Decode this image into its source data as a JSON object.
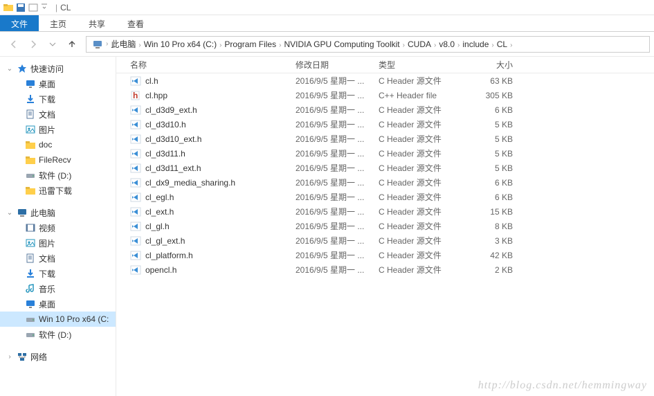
{
  "title_bar": {
    "text": "CL",
    "sep": "|"
  },
  "ribbon": {
    "file": "文件",
    "home": "主页",
    "share": "共享",
    "view": "查看"
  },
  "breadcrumbs": [
    "此电脑",
    "Win 10 Pro x64 (C:)",
    "Program Files",
    "NVIDIA GPU Computing Toolkit",
    "CUDA",
    "v8.0",
    "include",
    "CL"
  ],
  "columns": {
    "name": "名称",
    "date": "修改日期",
    "type": "类型",
    "size": "大小"
  },
  "sidebar": {
    "quick": {
      "label": "快速访问",
      "items": [
        {
          "label": "桌面",
          "icon": "desktop"
        },
        {
          "label": "下载",
          "icon": "download"
        },
        {
          "label": "文档",
          "icon": "document"
        },
        {
          "label": "图片",
          "icon": "picture"
        },
        {
          "label": "doc",
          "icon": "folder"
        },
        {
          "label": "FileRecv",
          "icon": "folder"
        },
        {
          "label": "软件 (D:)",
          "icon": "drive"
        },
        {
          "label": "迅雷下载",
          "icon": "folder"
        }
      ]
    },
    "pc": {
      "label": "此电脑",
      "items": [
        {
          "label": "视频",
          "icon": "video"
        },
        {
          "label": "图片",
          "icon": "picture"
        },
        {
          "label": "文档",
          "icon": "document"
        },
        {
          "label": "下载",
          "icon": "download"
        },
        {
          "label": "音乐",
          "icon": "music"
        },
        {
          "label": "桌面",
          "icon": "desktop"
        },
        {
          "label": "Win 10 Pro x64 (C:",
          "icon": "drive",
          "selected": true
        },
        {
          "label": "软件 (D:)",
          "icon": "drive"
        }
      ]
    },
    "network": {
      "label": "网络"
    }
  },
  "files": [
    {
      "name": "cl.h",
      "icon": "vs",
      "date": "2016/9/5 星期一 ...",
      "type": "C Header 源文件",
      "size": "63 KB"
    },
    {
      "name": "cl.hpp",
      "icon": "hpp",
      "date": "2016/9/5 星期一 ...",
      "type": "C++ Header file",
      "size": "305 KB"
    },
    {
      "name": "cl_d3d9_ext.h",
      "icon": "vs",
      "date": "2016/9/5 星期一 ...",
      "type": "C Header 源文件",
      "size": "6 KB"
    },
    {
      "name": "cl_d3d10.h",
      "icon": "vs",
      "date": "2016/9/5 星期一 ...",
      "type": "C Header 源文件",
      "size": "5 KB"
    },
    {
      "name": "cl_d3d10_ext.h",
      "icon": "vs",
      "date": "2016/9/5 星期一 ...",
      "type": "C Header 源文件",
      "size": "5 KB"
    },
    {
      "name": "cl_d3d11.h",
      "icon": "vs",
      "date": "2016/9/5 星期一 ...",
      "type": "C Header 源文件",
      "size": "5 KB"
    },
    {
      "name": "cl_d3d11_ext.h",
      "icon": "vs",
      "date": "2016/9/5 星期一 ...",
      "type": "C Header 源文件",
      "size": "5 KB"
    },
    {
      "name": "cl_dx9_media_sharing.h",
      "icon": "vs",
      "date": "2016/9/5 星期一 ...",
      "type": "C Header 源文件",
      "size": "6 KB"
    },
    {
      "name": "cl_egl.h",
      "icon": "vs",
      "date": "2016/9/5 星期一 ...",
      "type": "C Header 源文件",
      "size": "6 KB"
    },
    {
      "name": "cl_ext.h",
      "icon": "vs",
      "date": "2016/9/5 星期一 ...",
      "type": "C Header 源文件",
      "size": "15 KB"
    },
    {
      "name": "cl_gl.h",
      "icon": "vs",
      "date": "2016/9/5 星期一 ...",
      "type": "C Header 源文件",
      "size": "8 KB"
    },
    {
      "name": "cl_gl_ext.h",
      "icon": "vs",
      "date": "2016/9/5 星期一 ...",
      "type": "C Header 源文件",
      "size": "3 KB"
    },
    {
      "name": "cl_platform.h",
      "icon": "vs",
      "date": "2016/9/5 星期一 ...",
      "type": "C Header 源文件",
      "size": "42 KB"
    },
    {
      "name": "opencl.h",
      "icon": "vs",
      "date": "2016/9/5 星期一 ...",
      "type": "C Header 源文件",
      "size": "2 KB"
    }
  ],
  "watermark": "http://blog.csdn.net/hemmingway",
  "icon_colors": {
    "desktop": "#2980d9",
    "download": "#2980d9",
    "document": "#5a7a9e",
    "picture": "#2596be",
    "folder": "#ffcf4b",
    "drive": "#9aa6b2",
    "video": "#5a7a9e",
    "music": "#2596be",
    "star": "#2980d9",
    "pc": "#2c6ea5",
    "network": "#2c6ea5",
    "vs": "#3b8fd6",
    "hpp": "#c0392b"
  }
}
